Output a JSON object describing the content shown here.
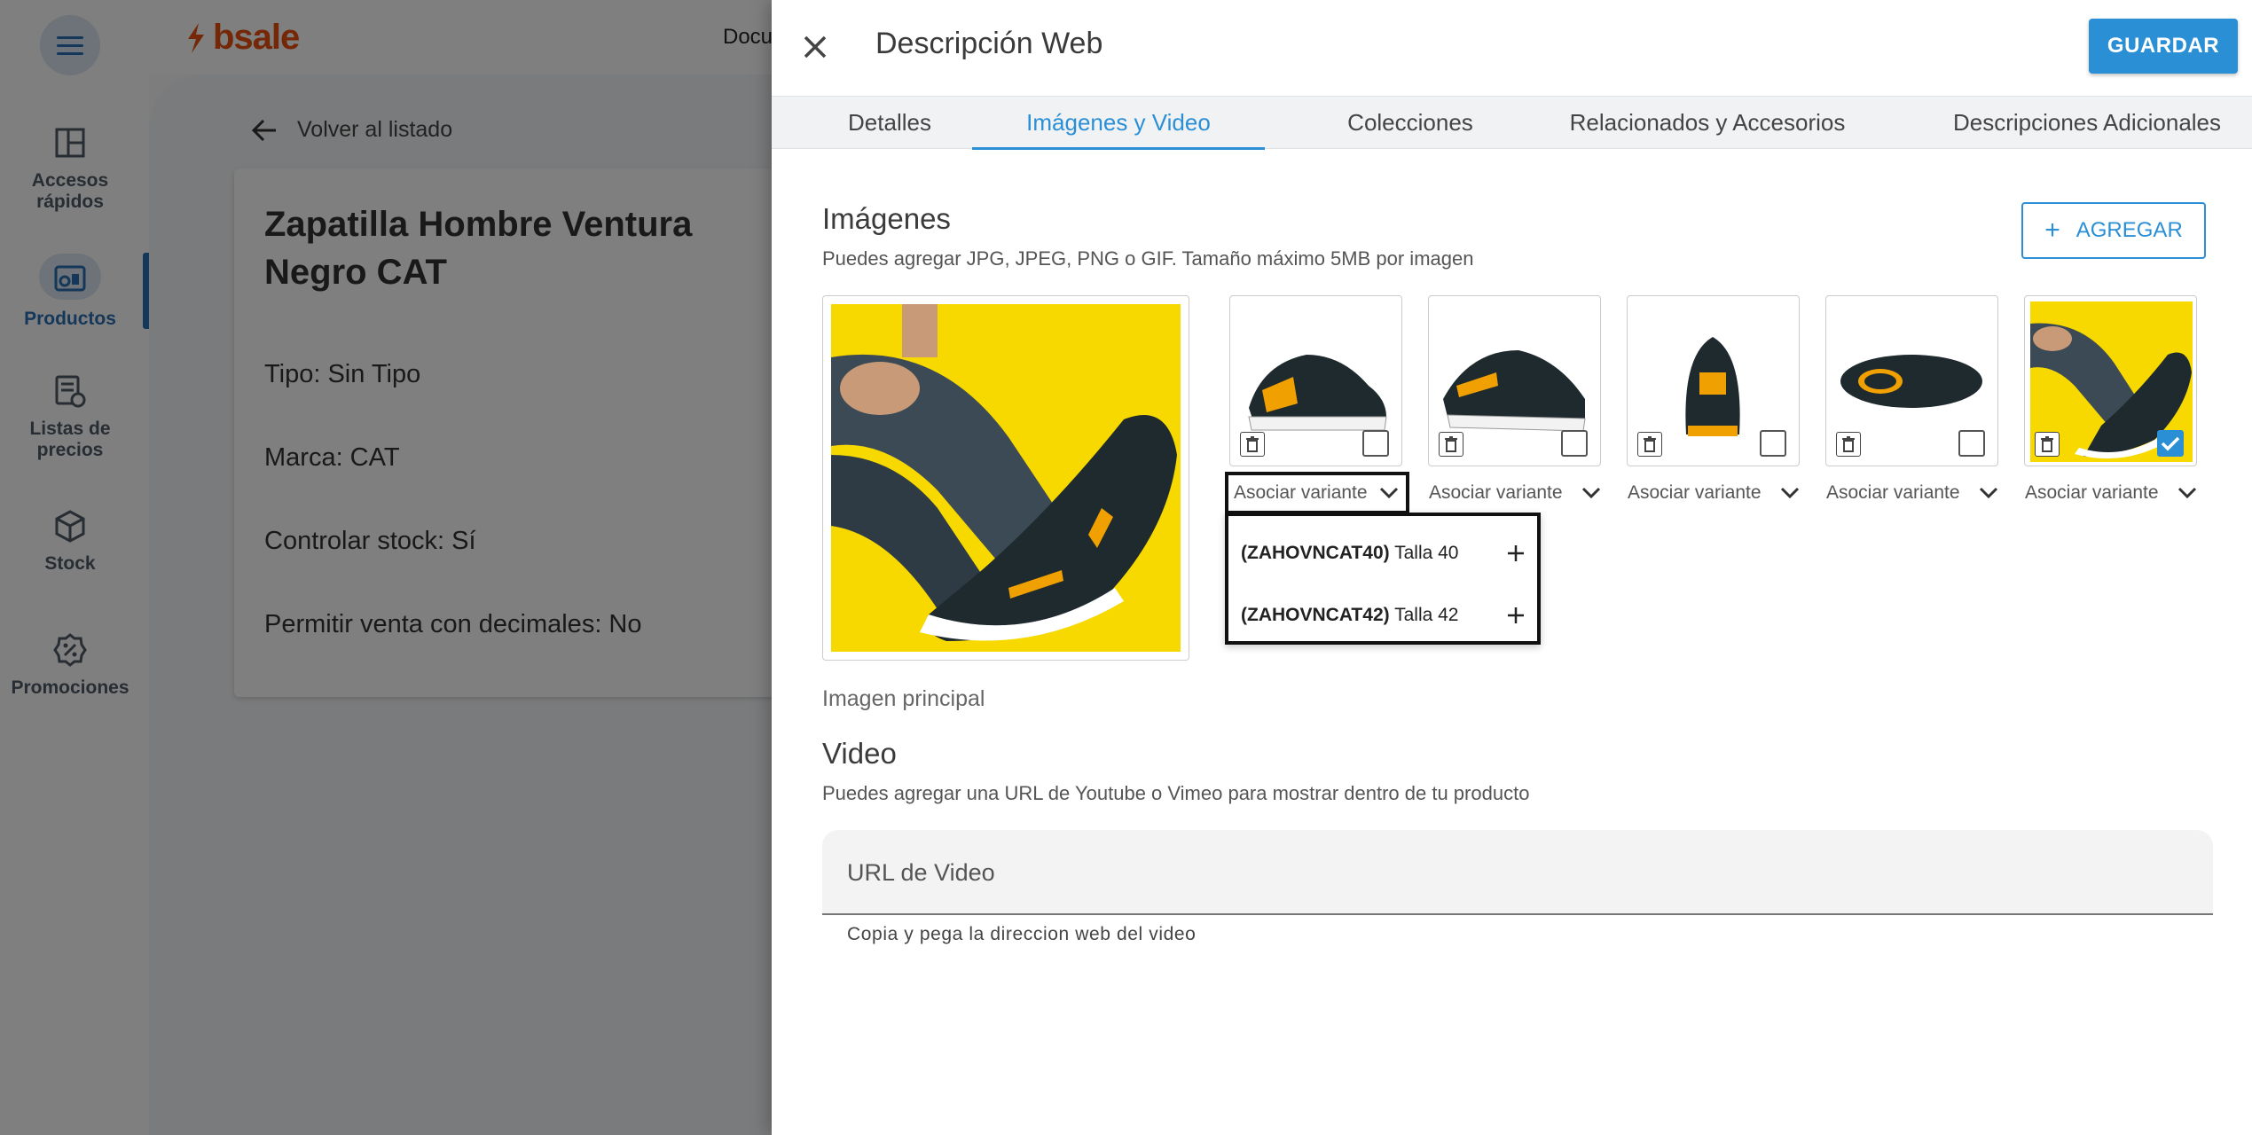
{
  "app": {
    "brand": "bsale",
    "top_partial_text": "Docu",
    "rail": [
      {
        "label": "Accesos rápidos",
        "icon": "dashboard-icon"
      },
      {
        "label": "Productos",
        "icon": "products-icon",
        "active": true
      },
      {
        "label": "Listas de precios",
        "icon": "price-list-icon"
      },
      {
        "label": "Stock",
        "icon": "cube-icon"
      },
      {
        "label": "Promociones",
        "icon": "discount-icon"
      }
    ],
    "back_link": "Volver al listado",
    "product": {
      "title": "Zapatilla Hombre Ventura Negro CAT",
      "type": "Tipo: Sin Tipo",
      "brand": "Marca: CAT",
      "stock": "Controlar stock: Sí",
      "decimals": "Permitir venta con decimales: No"
    }
  },
  "drawer": {
    "title": "Descripción Web",
    "save_label": "GUARDAR",
    "tabs": [
      {
        "label": "Detalles"
      },
      {
        "label": "Imágenes y Video",
        "active": true
      },
      {
        "label": "Colecciones"
      },
      {
        "label": "Relacionados y Accesorios"
      },
      {
        "label": "Descripciones Adicionales"
      }
    ],
    "images": {
      "title": "Imágenes",
      "description": "Puedes agregar JPG, JPEG, PNG o GIF. Tamaño máximo 5MB por imagen",
      "add_label": "AGREGAR",
      "main_caption": "Imagen principal",
      "variant_label": "Asociar variante",
      "thumbnails": [
        {
          "checked": false
        },
        {
          "checked": false
        },
        {
          "checked": false
        },
        {
          "checked": false
        },
        {
          "checked": true
        }
      ],
      "dropdown_options": [
        {
          "code": "(ZAHOVNCAT40)",
          "label": "Talla 40"
        },
        {
          "code": "(ZAHOVNCAT42)",
          "label": "Talla 42"
        }
      ]
    },
    "video": {
      "title": "Video",
      "description": "Puedes agregar una URL de Youtube o Vimeo para mostrar dentro de tu producto",
      "placeholder": "URL de Video",
      "helper": "Copia y pega la direccion web del video"
    }
  },
  "colors": {
    "accent": "#2b8fd6",
    "brand": "#e8500f",
    "image_bg": "#f7d900"
  }
}
